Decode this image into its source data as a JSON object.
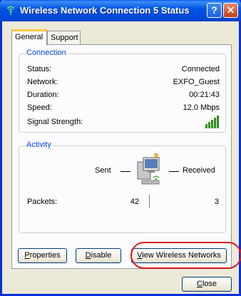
{
  "window": {
    "title": "Wireless Network Connection 5 Status",
    "help_symbol": "?",
    "close_symbol": "✕"
  },
  "tabs": [
    {
      "label": "General",
      "active": true
    },
    {
      "label": "Support",
      "active": false
    }
  ],
  "connection": {
    "group_title": "Connection",
    "rows": [
      {
        "label": "Status:",
        "value": "Connected"
      },
      {
        "label": "Network:",
        "value": "EXFO_Guest"
      },
      {
        "label": "Duration:",
        "value": "00:21:43"
      },
      {
        "label": "Speed:",
        "value": "12.0 Mbps"
      },
      {
        "label": "Signal Strength:",
        "value": ""
      }
    ],
    "signal_bars": 5,
    "signal_color": "#2d8f1a"
  },
  "activity": {
    "group_title": "Activity",
    "sent_label": "Sent",
    "received_label": "Received",
    "packets_label": "Packets:",
    "packets_sent": "42",
    "packets_received": "3"
  },
  "buttons": {
    "properties": {
      "prefix": "",
      "key": "P",
      "rest": "roperties"
    },
    "disable": {
      "prefix": "",
      "key": "D",
      "rest": "isable"
    },
    "view_networks": {
      "prefix": "",
      "key": "V",
      "rest": "iew Wireless Networks"
    },
    "close": {
      "prefix": "",
      "key": "C",
      "rest": "lose"
    }
  },
  "colors": {
    "titlebar": "#0055e5",
    "group_title": "#0046d5",
    "highlight_ring": "#d7161b"
  }
}
